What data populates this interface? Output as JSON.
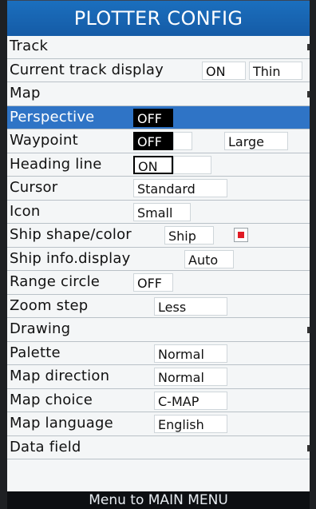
{
  "title": "PLOTTER CONFIG",
  "rows": [
    {
      "label": "Track",
      "values": [],
      "arrow": true
    },
    {
      "label": "Current track display",
      "values": [
        "ON",
        "Thin"
      ]
    },
    {
      "label": "Map",
      "values": [],
      "arrow": true
    },
    {
      "label": "Perspective",
      "values": [
        "OFF"
      ],
      "selected": true
    },
    {
      "label": "Waypoint",
      "values": [
        "OFF",
        "Large"
      ]
    },
    {
      "label": "Heading line",
      "values": [
        "ON"
      ]
    },
    {
      "label": "Cursor",
      "values": [
        "Standard"
      ]
    },
    {
      "label": "Icon",
      "values": [
        "Small"
      ]
    },
    {
      "label": "Ship shape/color",
      "values": [
        "Ship"
      ],
      "swatch_color": "#e01b24"
    },
    {
      "label": "Ship info.display",
      "values": [
        "Auto"
      ]
    },
    {
      "label": "Range circle",
      "values": [
        "OFF"
      ]
    },
    {
      "label": "Zoom step",
      "values": [
        "Less"
      ]
    },
    {
      "label": "Drawing",
      "values": [],
      "arrow": true
    },
    {
      "label": "Palette",
      "values": [
        "Normal"
      ]
    },
    {
      "label": "Map direction",
      "values": [
        "Normal"
      ]
    },
    {
      "label": "Map choice",
      "values": [
        "C-MAP"
      ]
    },
    {
      "label": "Map language",
      "values": [
        "English"
      ]
    },
    {
      "label": "Data field",
      "values": [],
      "arrow": true
    }
  ],
  "footer": "Menu to MAIN MENU",
  "colors": {
    "title_bar": "#1b6fbe",
    "selected_row": "#2f74c6",
    "swatch": "#e01b24"
  }
}
